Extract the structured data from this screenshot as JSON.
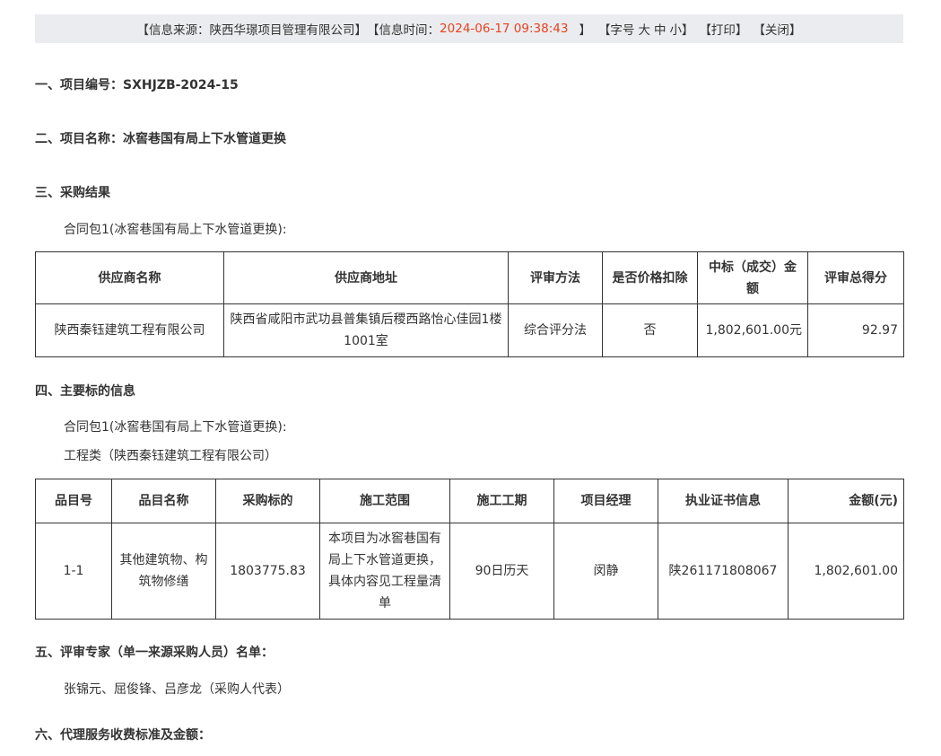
{
  "topbar": {
    "source": "【信息来源：陕西华璟项目管理有限公司】",
    "time_label": "【信息时间：",
    "time_value": "2024-06-17 09:38:43",
    "time_close": "】",
    "font_size": "【字号",
    "font_large": "大",
    "font_medium": "中",
    "font_small": "小】",
    "print": "【打印】",
    "close": "【关闭】"
  },
  "sections": {
    "s1": "一、项目编号：SXHJZB-2024-15",
    "s2": "二、项目名称：冰窖巷国有局上下水管道更换",
    "s3": "三、采购结果",
    "s4": "四、主要标的信息",
    "s5": "五、评审专家（单一来源采购人员）名单：",
    "s6": "六、代理服务收费标准及金额："
  },
  "result": {
    "package": "合同包1(冰窖巷国有局上下水管道更换):",
    "headers": [
      "供应商名称",
      "供应商地址",
      "评审方法",
      "是否价格扣除",
      "中标（成交）金额",
      "评审总得分"
    ],
    "row": {
      "name": "陕西秦钰建筑工程有限公司",
      "address": "陕西省咸阳市武功县普集镇后稷西路怡心佳园1楼1001室",
      "method": "综合评分法",
      "deduction": "否",
      "amount": "1,802,601.00元",
      "score": "92.97"
    }
  },
  "items": {
    "package": "合同包1(冰窖巷国有局上下水管道更换):",
    "category": "工程类（陕西秦钰建筑工程有限公司）",
    "headers": [
      "品目号",
      "品目名称",
      "采购标的",
      "施工范围",
      "施工工期",
      "项目经理",
      "执业证书信息",
      "金额(元)"
    ],
    "row": {
      "no": "1-1",
      "name": "其他建筑物、构筑物修缮",
      "target": "1803775.83",
      "scope": "本项目为冰窖巷国有局上下水管道更换，具体内容见工程量清单",
      "period": "90日历天",
      "manager": "闵静",
      "cert": "陕261171808067",
      "amount": "1,802,601.00"
    }
  },
  "experts": "张锦元、屈俊锋、吕彦龙（采购人代表）"
}
